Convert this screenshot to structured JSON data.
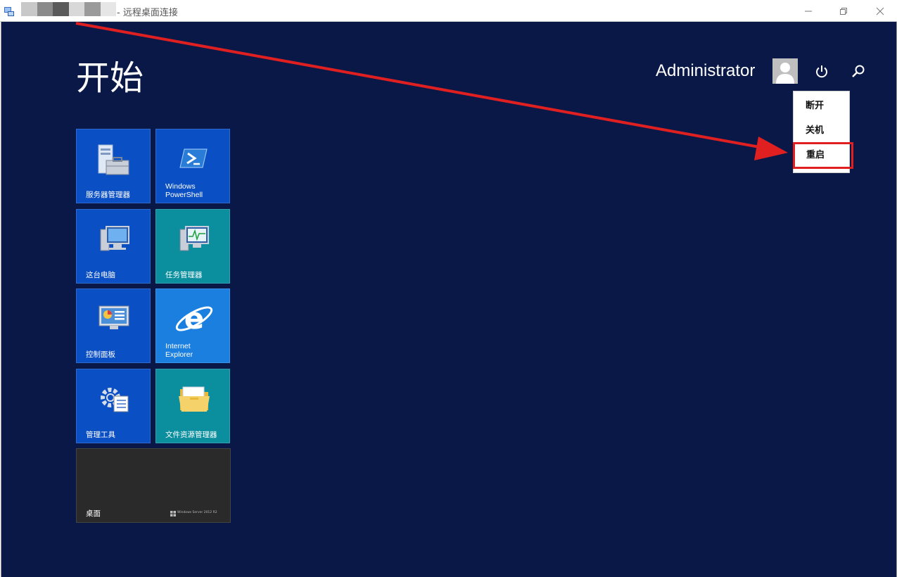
{
  "window": {
    "title": "- 远程桌面连接",
    "controls": [
      "minimize-icon",
      "restore-icon",
      "close-icon"
    ]
  },
  "start": {
    "title": "开始",
    "user": "Administrator"
  },
  "power_menu": {
    "items": [
      {
        "label": "断开"
      },
      {
        "label": "关机"
      },
      {
        "label": "重启"
      }
    ],
    "highlight_color": "#e02020"
  },
  "tiles": [
    {
      "label": "服务器管理器",
      "color": "#0a4fc4",
      "icon": "server-manager-icon"
    },
    {
      "label": "Windows\nPowerShell",
      "color": "#0a4fc4",
      "icon": "powershell-icon"
    },
    {
      "label": "这台电脑",
      "color": "#0a4fc4",
      "icon": "computer-icon"
    },
    {
      "label": "任务管理器",
      "color": "#0b8f9e",
      "icon": "task-manager-icon"
    },
    {
      "label": "控制面板",
      "color": "#0a4fc4",
      "icon": "control-panel-icon"
    },
    {
      "label": "Internet\nExplorer",
      "color": "#1b7fe0",
      "icon": "internet-explorer-icon"
    },
    {
      "label": "管理工具",
      "color": "#0a4fc4",
      "icon": "admin-tools-icon"
    },
    {
      "label": "文件资源管理器",
      "color": "#0b8f9e",
      "icon": "file-explorer-icon"
    }
  ],
  "desktop_tile": {
    "label": "桌面",
    "logo_text": "Windows Server 2012 R2"
  },
  "colors": {
    "background": "#0a1848",
    "arrow": "#e02020"
  }
}
